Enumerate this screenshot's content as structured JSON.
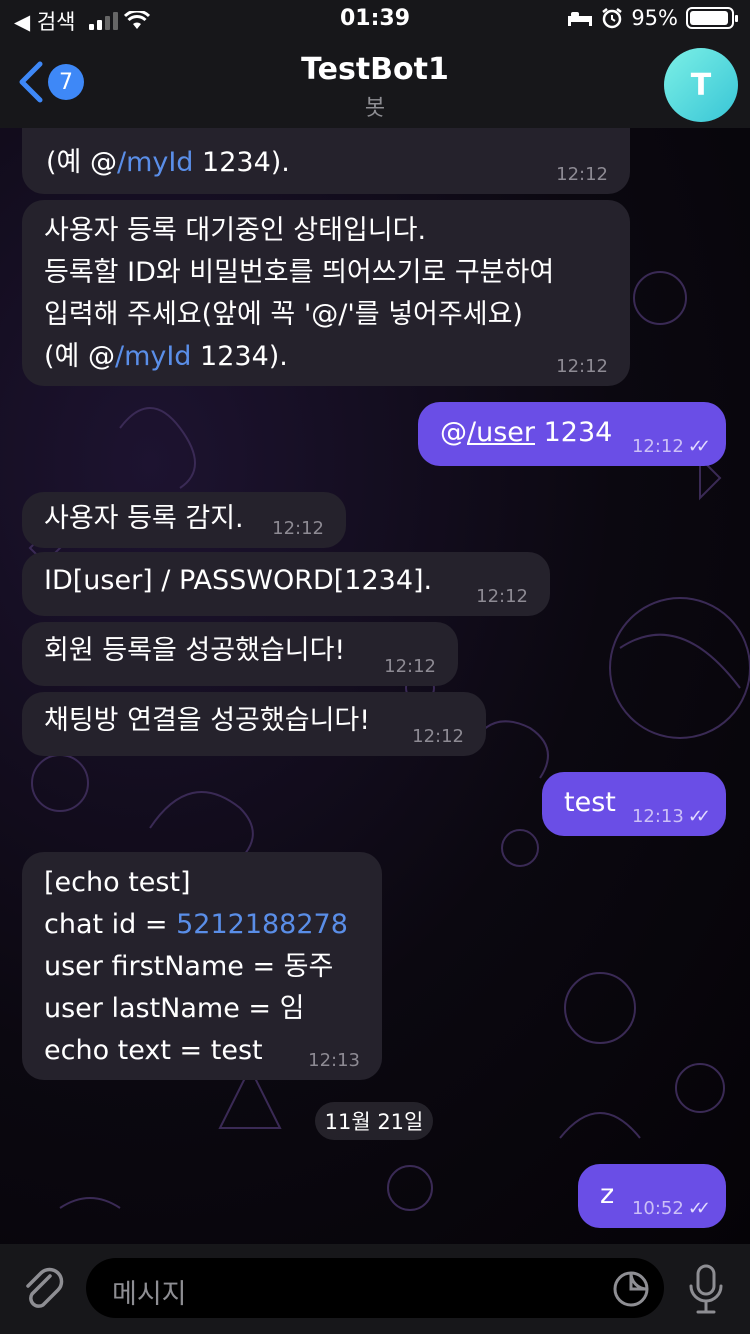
{
  "status_bar": {
    "back_app": "◀ 검색",
    "time": "01:39",
    "battery_text": "95%",
    "battery_level": 0.95
  },
  "header": {
    "unread_count": "7",
    "title": "TestBot1",
    "subtitle": "봇",
    "avatar_letter": "T",
    "avatar_color": "#4fd6dc"
  },
  "messages": [
    {
      "lines_plain": "(예 @",
      "link": "/myId",
      "after": " 1234).",
      "time": "12:12"
    },
    {
      "line1": "사용자 등록 대기중인 상태입니다.",
      "line2": "등록할 ID와 비밀번호를 띄어쓰기로 구분하여",
      "line3": "입력해 주세요(앞에 꼭 '@/'를 넣어주세요)",
      "line4_pre": "(예 @",
      "line4_link": "/myId",
      "line4_post": " 1234).",
      "time": "12:12"
    },
    {
      "pre": "@",
      "link": "/user",
      "post": " 1234",
      "time": "12:12"
    },
    {
      "text": "사용자 등록 감지.",
      "time": "12:12"
    },
    {
      "text": "ID[user] / PASSWORD[1234].",
      "time": "12:12"
    },
    {
      "text": "회원 등록을 성공했습니다!",
      "time": "12:12"
    },
    {
      "text": "채팅방 연결을 성공했습니다!",
      "time": "12:12"
    },
    {
      "text": "test",
      "time": "12:13"
    },
    {
      "line1": "[echo test]",
      "line2_pre": "chat id = ",
      "line2_link": "5212188278",
      "line3": "user firstName = 동주",
      "line4": "user lastName = 임",
      "line5": "echo text = test",
      "time": "12:13"
    },
    {
      "text": "z",
      "time": "10:52"
    }
  ],
  "date_separator": "11월 21일",
  "input": {
    "placeholder": "메시지"
  },
  "colors": {
    "outgoing_bubble": "#6a4ee6",
    "incoming_bubble": "#25222c",
    "link": "#5a8ee8"
  }
}
